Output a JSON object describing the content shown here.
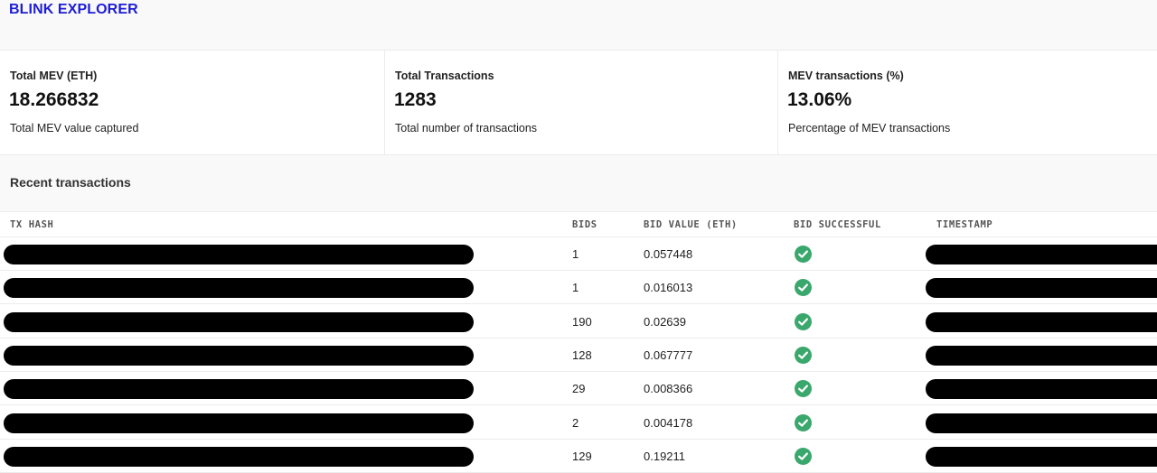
{
  "header": {
    "brand": "BLINK EXPLORER"
  },
  "stats": [
    {
      "label": "Total MEV (ETH)",
      "value": "18.266832",
      "desc": "Total MEV value captured"
    },
    {
      "label": "Total Transactions",
      "value": "1283",
      "desc": "Total number of transactions"
    },
    {
      "label": "MEV transactions (%)",
      "value": "13.06%",
      "desc": "Percentage of MEV transactions"
    }
  ],
  "section": {
    "title": "Recent transactions"
  },
  "table": {
    "columns": [
      "TX HASH",
      "BIDS",
      "BID VALUE (ETH)",
      "BID SUCCESSFUL",
      "TIMESTAMP"
    ],
    "rows": [
      {
        "bids": "1",
        "bid_value": "0.057448",
        "successful": true
      },
      {
        "bids": "1",
        "bid_value": "0.016013",
        "successful": true
      },
      {
        "bids": "190",
        "bid_value": "0.02639",
        "successful": true
      },
      {
        "bids": "128",
        "bid_value": "0.067777",
        "successful": true
      },
      {
        "bids": "29",
        "bid_value": "0.008366",
        "successful": true
      },
      {
        "bids": "2",
        "bid_value": "0.004178",
        "successful": true
      },
      {
        "bids": "129",
        "bid_value": "0.19211",
        "successful": true
      }
    ]
  },
  "colors": {
    "brand": "#1d1dd8",
    "success": "#3aa76d"
  },
  "icons": {
    "success": "check-circle-icon"
  }
}
